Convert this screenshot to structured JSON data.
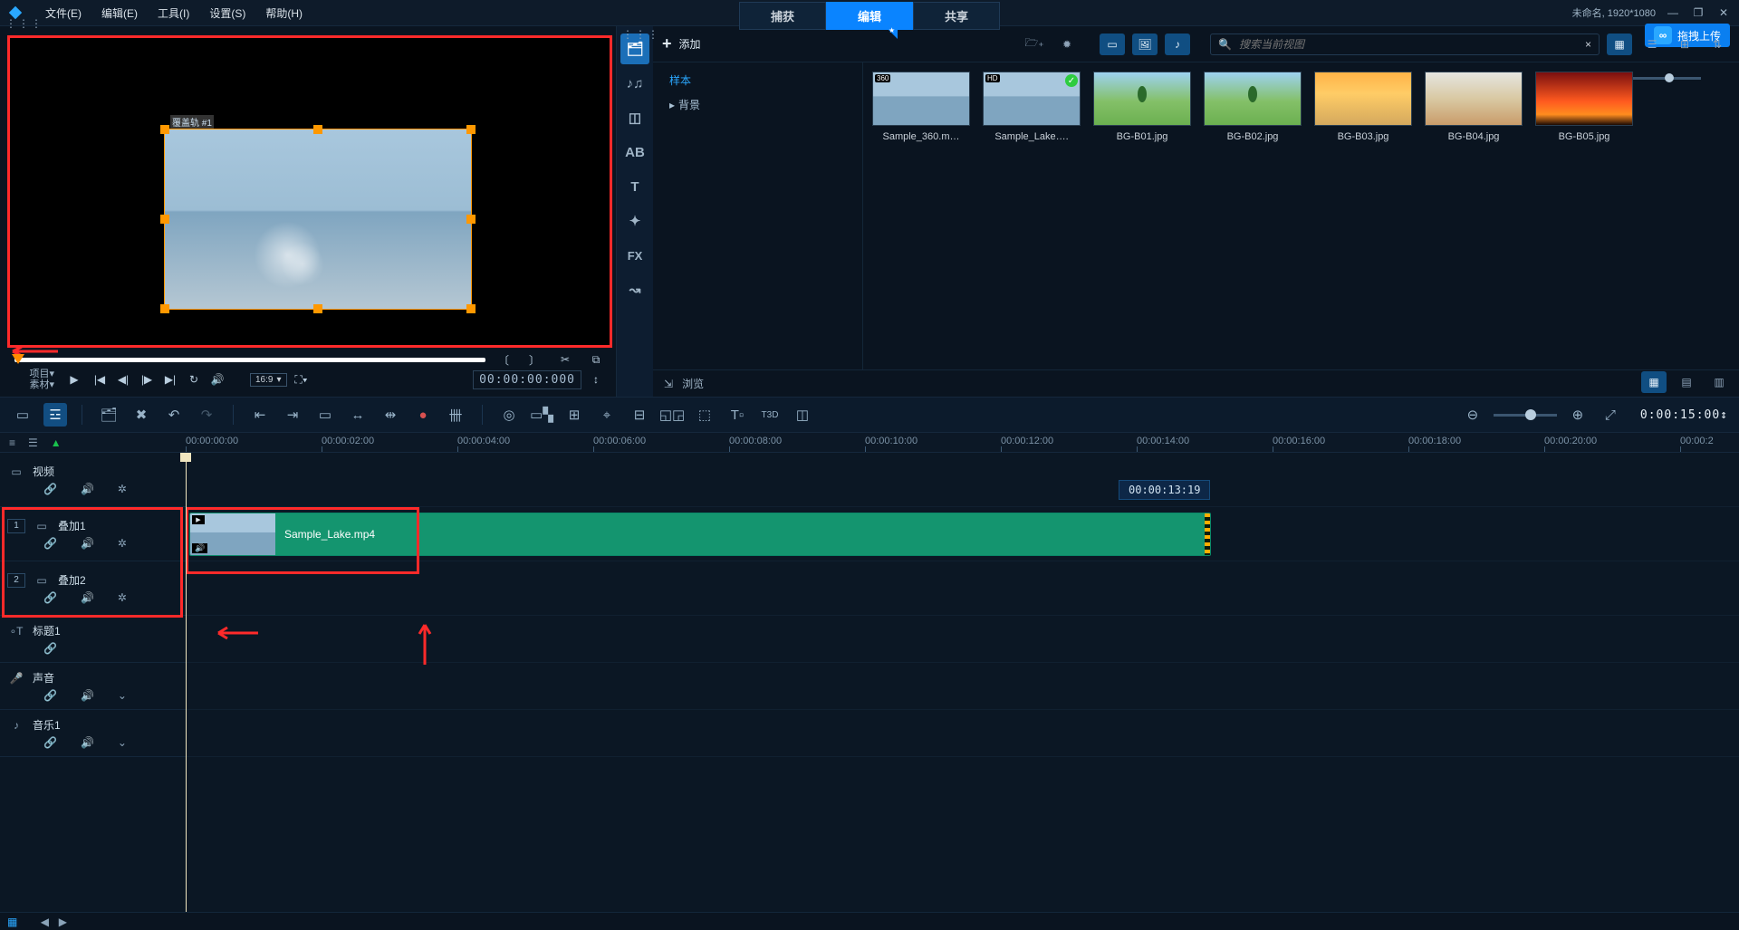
{
  "window": {
    "status": "未命名, 1920*1080",
    "upload_badge": "拖拽上传",
    "upload_badge_icon": "∞"
  },
  "menu": {
    "file": "文件(E)",
    "edit": "编辑(E)",
    "tools": "工具(I)",
    "settings": "设置(S)",
    "help": "帮助(H)"
  },
  "main_tabs": {
    "capture": "捕获",
    "edit": "编辑",
    "share": "共享",
    "active": "edit"
  },
  "preview": {
    "overlay_label": "覆盖轨 #1",
    "mode_a": "项目▾",
    "mode_b": "素材▾",
    "ratio": "16:9",
    "timecode": "00:00:00:000"
  },
  "library": {
    "add": "添加",
    "tree": {
      "samples": "样本",
      "background": "背景"
    },
    "search_placeholder": "搜索当前视图",
    "browse": "浏览",
    "thumbs": [
      {
        "name": "Sample_360.m…",
        "type": "sky",
        "badge": "360"
      },
      {
        "name": "Sample_Lake….",
        "type": "sky",
        "badge": "HD",
        "check": true
      },
      {
        "name": "BG-B01.jpg",
        "type": "tree"
      },
      {
        "name": "BG-B02.jpg",
        "type": "tree"
      },
      {
        "name": "BG-B03.jpg",
        "type": "sunset"
      },
      {
        "name": "BG-B04.jpg",
        "type": "dune"
      },
      {
        "name": "BG-B05.jpg",
        "type": "redsky"
      }
    ],
    "tool_fx": "FX",
    "tool_t": "T",
    "tool_ab": "AB"
  },
  "timeline": {
    "zoom_tc": "0:00:15:00↕",
    "hover_tc": "00:00:13:19",
    "ruler_marks": [
      "00:00:00:00",
      "00:00:02:00",
      "00:00:04:00",
      "00:00:06:00",
      "00:00:08:00",
      "00:00:10:00",
      "00:00:12:00",
      "00:00:14:00",
      "00:00:16:00",
      "00:00:18:00",
      "00:00:20:00",
      "00:00:2"
    ],
    "tracks": {
      "video": "视频",
      "ovl1": "叠加1",
      "ovl2": "叠加2",
      "title": "标题1",
      "audio": "声音",
      "music": "音乐1"
    },
    "clip_name": "Sample_Lake.mp4"
  },
  "track_idx": {
    "ovl1": "1",
    "ovl2": "2"
  }
}
